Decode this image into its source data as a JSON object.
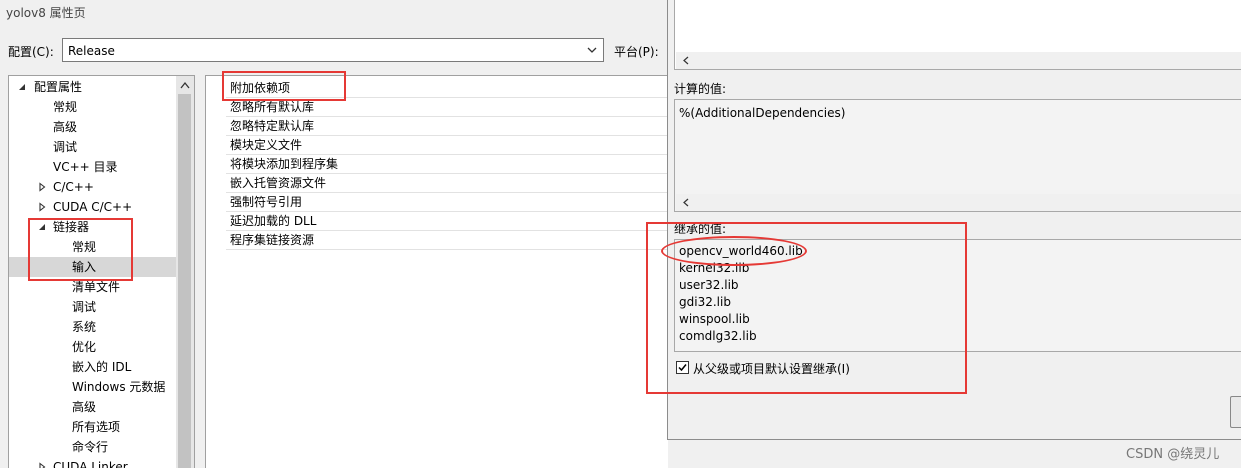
{
  "window": {
    "title": "yolov8 属性页"
  },
  "config": {
    "label": "配置(C):",
    "value": "Release",
    "platform_label": "平台(P):"
  },
  "tree": {
    "items": [
      {
        "label": "配置属性",
        "expanded": true
      },
      {
        "label": "常规"
      },
      {
        "label": "高级"
      },
      {
        "label": "调试"
      },
      {
        "label": "VC++ 目录"
      },
      {
        "label": "C/C++",
        "collapsed": true
      },
      {
        "label": "CUDA C/C++",
        "collapsed": true
      },
      {
        "label": "链接器",
        "expanded": true
      },
      {
        "label": "常规"
      },
      {
        "label": "输入",
        "selected": true
      },
      {
        "label": "清单文件"
      },
      {
        "label": "调试"
      },
      {
        "label": "系统"
      },
      {
        "label": "优化"
      },
      {
        "label": "嵌入的 IDL"
      },
      {
        "label": "Windows 元数据"
      },
      {
        "label": "高级"
      },
      {
        "label": "所有选项"
      },
      {
        "label": "命令行"
      },
      {
        "label": "CUDA Linker",
        "collapsed": true
      }
    ]
  },
  "properties": {
    "rows": [
      "附加依赖项",
      "忽略所有默认库",
      "忽略特定默认库",
      "模块定义文件",
      "将模块添加到程序集",
      "嵌入托管资源文件",
      "强制符号引用",
      "延迟加载的 DLL",
      "程序集链接资源"
    ]
  },
  "dialog": {
    "evaluated_label": "计算的值:",
    "evaluated_value": "%(AdditionalDependencies)",
    "inherited_label": "继承的值:",
    "inherited_values": [
      "opencv_world460.lib",
      "kernel32.lib",
      "user32.lib",
      "gdi32.lib",
      "winspool.lib",
      "comdlg32.lib"
    ],
    "inherit_checkbox_label": "从父级或项目默认设置继承(I)",
    "inherit_checked": true
  },
  "watermark": "CSDN @绕灵儿",
  "colors": {
    "annotation": "#e53935",
    "selected_row": "#d7d7d7"
  }
}
